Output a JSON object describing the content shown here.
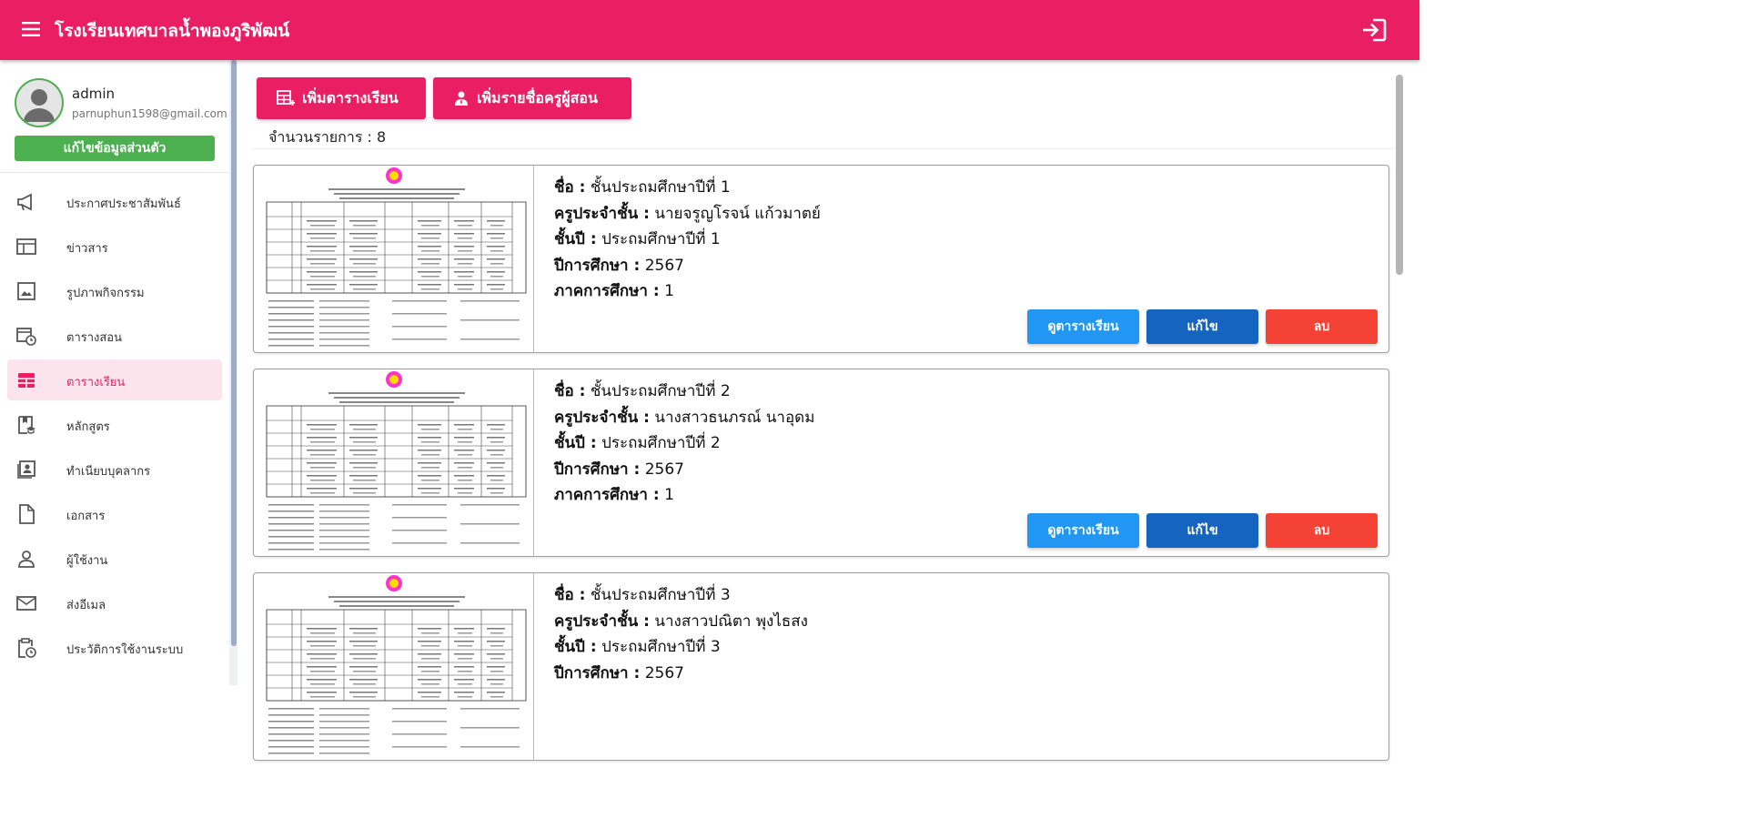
{
  "header": {
    "title": "โรงเรียนเทศบาลน้ำพองภูริพัฒน์",
    "menu_icon": "hamburger-menu-icon",
    "logout_icon": "logout-icon"
  },
  "sidebar": {
    "user": {
      "name": "admin",
      "email": "parnuphun1598@gmail.com",
      "edit_label": "แก้ไขข้อมูลส่วนตัว"
    },
    "items": [
      {
        "label": "ประกาศประชาสัมพันธ์",
        "icon": "megaphone-icon"
      },
      {
        "label": "ข่าวสาร",
        "icon": "news-icon"
      },
      {
        "label": "รูปภาพกิจกรรม",
        "icon": "image-icon"
      },
      {
        "label": "ตารางสอน",
        "icon": "calendar-clock-icon"
      },
      {
        "label": "ตารางเรียน",
        "icon": "table-icon",
        "active": true
      },
      {
        "label": "หลักสูตร",
        "icon": "book-education-icon"
      },
      {
        "label": "ทำเนียบบุคลากร",
        "icon": "contact-card-icon"
      },
      {
        "label": "เอกสาร",
        "icon": "document-icon"
      },
      {
        "label": "ผู้ใช้งาน",
        "icon": "user-icon"
      },
      {
        "label": "ส่งอีเมล",
        "icon": "mail-icon"
      },
      {
        "label": "ประวัติการใช้งานระบบ",
        "icon": "history-clipboard-icon"
      }
    ]
  },
  "toolbar": {
    "add_schedule_label": "เพิ่มตารางเรียน",
    "add_teacher_label": "เพิ่มรายชื่อครูผู้สอน"
  },
  "count_label": "จำนวนรายการ : 8",
  "labels": {
    "name": "ชื่อ :",
    "teacher": "ครูประจำชั้น :",
    "grade": "ชั้นปี :",
    "year": "ปีการศึกษา :",
    "term": "ภาคการศึกษา :"
  },
  "actions": {
    "view": "ดูตารางเรียน",
    "edit": "แก้ไข",
    "delete": "ลบ"
  },
  "cards": [
    {
      "name": "ชั้นประถมศึกษาปีที่ 1",
      "teacher": "นายจรูญโรจน์ แก้วมาตย์",
      "grade": "ประถมศึกษาปีที่ 1",
      "year": "2567",
      "term": "1"
    },
    {
      "name": "ชั้นประถมศึกษาปีที่ 2",
      "teacher": "นางสาวธนภรณ์ นาอุดม",
      "grade": "ประถมศึกษาปีที่ 2",
      "year": "2567",
      "term": "1"
    },
    {
      "name": "ชั้นประถมศึกษาปีที่ 3",
      "teacher": "นางสาวปณิตา พุงไธสง",
      "grade": "ประถมศึกษาปีที่ 3",
      "year": "2567",
      "term": ""
    }
  ],
  "colors": {
    "brand": "#e91e63",
    "success": "#4caf50",
    "view": "#2196f3",
    "edit": "#1565c0",
    "delete": "#f44336"
  }
}
